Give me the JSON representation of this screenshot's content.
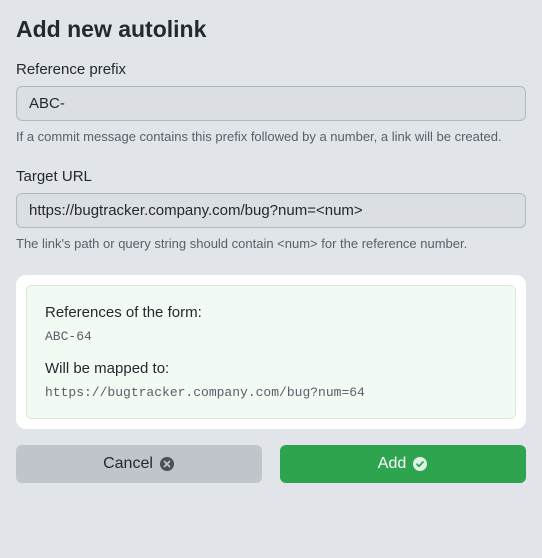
{
  "title": "Add new autolink",
  "referencePrefix": {
    "label": "Reference prefix",
    "value": "ABC-",
    "helper": "If a commit message contains this prefix followed by a number, a link will be created."
  },
  "targetUrl": {
    "label": "Target URL",
    "value": "https://bugtracker.company.com/bug?num=<num>",
    "helper": "The link's path or query string should contain <num> for the reference number."
  },
  "preview": {
    "referencesLabel": "References of the form:",
    "referencesValue": "ABC-64",
    "mappedLabel": "Will be mapped to:",
    "mappedValue": "https://bugtracker.company.com/bug?num=64"
  },
  "buttons": {
    "cancel": "Cancel",
    "add": "Add"
  }
}
